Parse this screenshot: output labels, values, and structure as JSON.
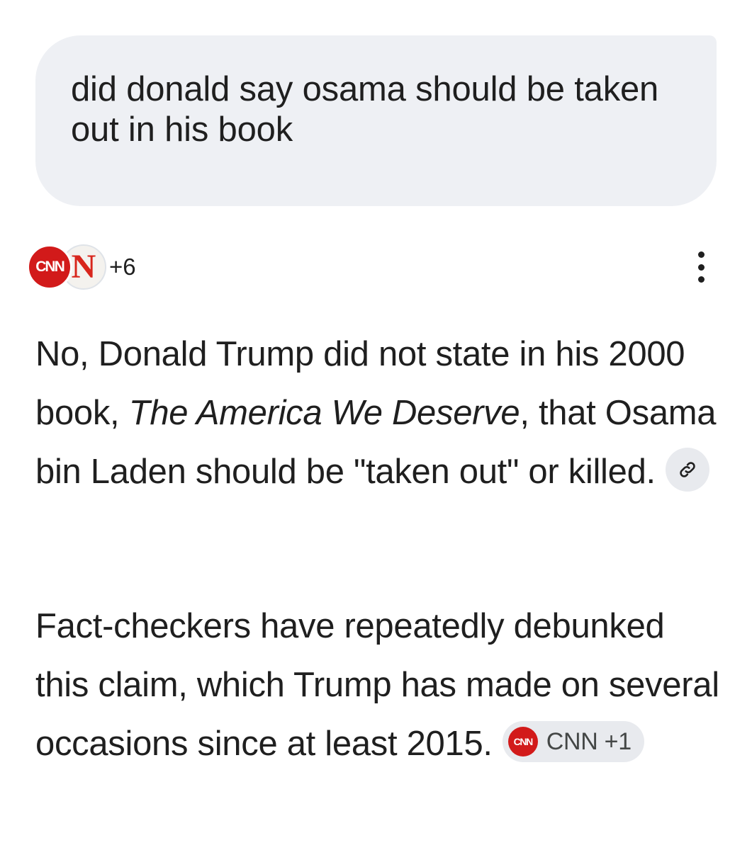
{
  "query": {
    "text": "did donald say osama should be taken out in his book"
  },
  "sources": {
    "logos": [
      "CNN",
      "N"
    ],
    "more_count": "+6"
  },
  "menu": {
    "icon": "more-vert-icon"
  },
  "answer": {
    "p1_before": "No, Donald Trump did not state in his 2000 book, ",
    "p1_title": "The America We Deserve",
    "p1_after": ", that Osama bin Laden should be \"taken out\" or killed.",
    "p1_link_icon": "link-icon",
    "p2_text": "Fact-checkers have repeatedly debunked this claim, which Trump has made on several occasions since at least 2015.",
    "p2_chip_logo": "CNN",
    "p2_chip_label": "CNN +1"
  },
  "colors": {
    "bubble_bg": "#eef0f4",
    "chip_bg": "#e8eaee",
    "cnn_red": "#d21a1a",
    "text": "#1f1f1f"
  }
}
